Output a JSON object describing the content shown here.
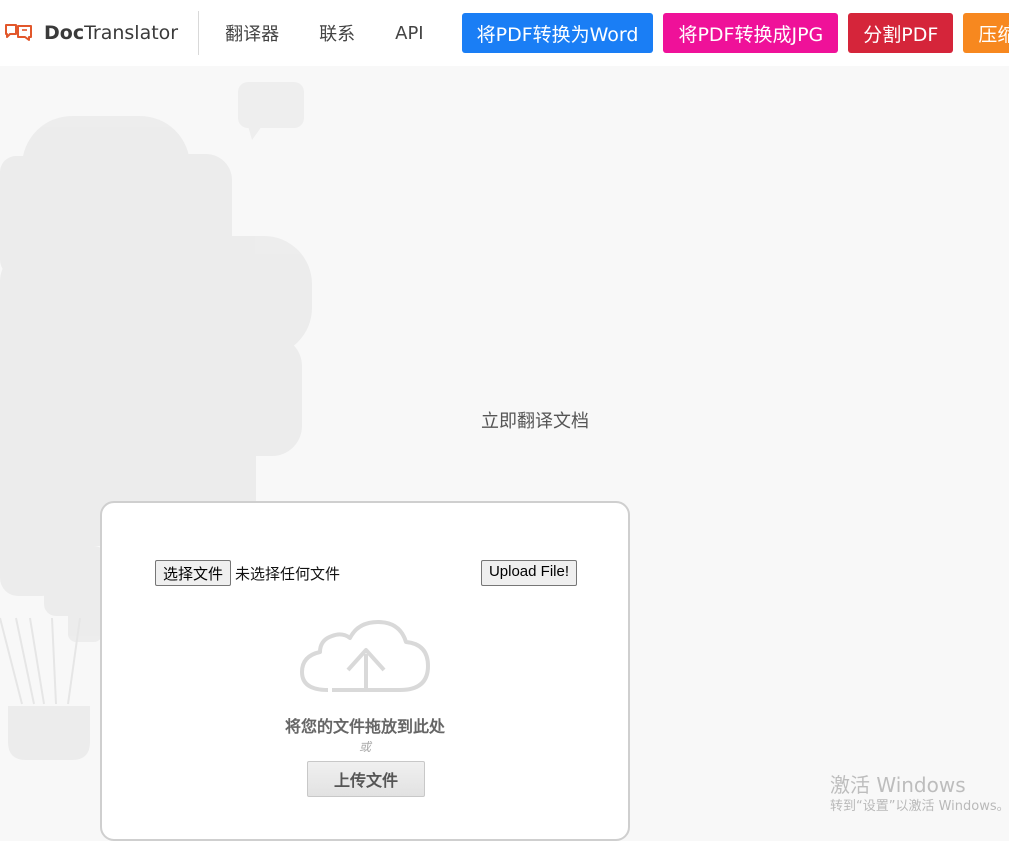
{
  "header": {
    "brand_part1": "Doc",
    "brand_part2": "Translator",
    "nav": [
      "翻译器",
      "联系",
      "API"
    ],
    "tools": [
      {
        "label": "将PDF转换为Word",
        "color": "#1a7ef5"
      },
      {
        "label": "将PDF转换成JPG",
        "color": "#ef1199"
      },
      {
        "label": "分割PDF",
        "color": "#d5253a"
      },
      {
        "label": "压缩",
        "color": "#f7881f"
      }
    ]
  },
  "main": {
    "tagline": "立即翻译文档",
    "choose_file_label": "选择文件",
    "file_status": "未选择任何文件",
    "upload_submit_label": "Upload File!",
    "drop_text": "将您的文件拖放到此处",
    "or_text": "或",
    "upload_button_label": "上传文件"
  },
  "watermark": {
    "title": "激活 Windows",
    "subtitle": "转到“设置”以激活 Windows。"
  },
  "icons": {
    "brand": "chat-bubbles-logo-icon",
    "upload": "cloud-upload-icon"
  }
}
